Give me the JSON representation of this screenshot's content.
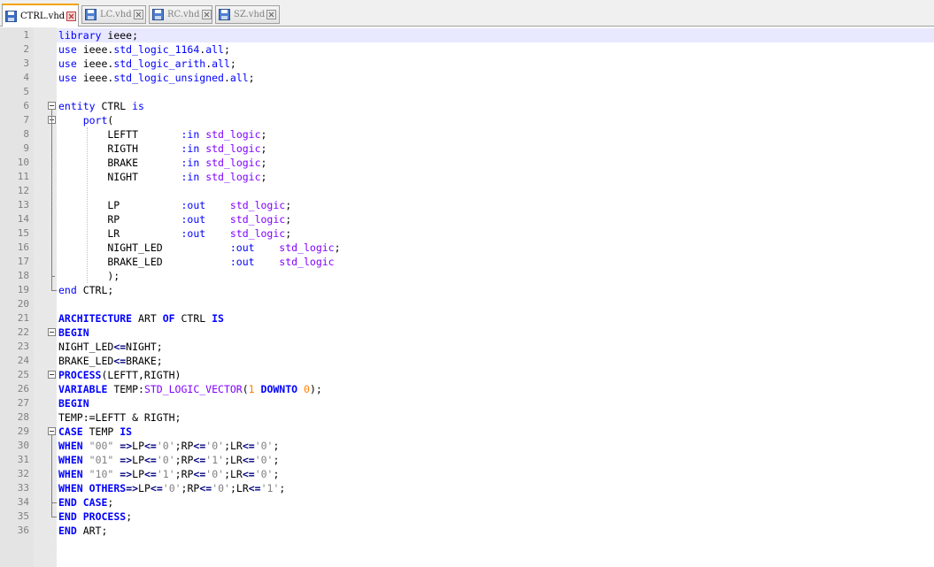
{
  "tabs": [
    {
      "label": "CTRL.vhd",
      "active": true,
      "icon": "save-icon"
    },
    {
      "label": "LC.vhd",
      "active": false,
      "icon": "save-icon"
    },
    {
      "label": "RC.vhd",
      "active": false,
      "icon": "save-icon"
    },
    {
      "label": "SZ.vhd",
      "active": false,
      "icon": "save-icon"
    }
  ],
  "colors": {
    "keyword": "#0000ff",
    "type": "#8000ff",
    "string": "#808080",
    "number": "#ff8000",
    "current_line": "#e8e8ff",
    "active_tab_accent": "#f4a300"
  },
  "editor": {
    "current_line": 1,
    "lines": [
      [
        [
          "k2",
          "library"
        ],
        [
          "id",
          " ieee;"
        ]
      ],
      [
        [
          "k2",
          "use"
        ],
        [
          "id",
          " ieee."
        ],
        [
          "k2",
          "std_logic_1164"
        ],
        [
          "id",
          "."
        ],
        [
          "k2",
          "all"
        ],
        [
          "id",
          ";"
        ]
      ],
      [
        [
          "k2",
          "use"
        ],
        [
          "id",
          " ieee."
        ],
        [
          "k2",
          "std_logic_arith"
        ],
        [
          "id",
          "."
        ],
        [
          "k2",
          "all"
        ],
        [
          "id",
          ";"
        ]
      ],
      [
        [
          "k2",
          "use"
        ],
        [
          "id",
          " ieee."
        ],
        [
          "k2",
          "std_logic_unsigned"
        ],
        [
          "id",
          "."
        ],
        [
          "k2",
          "all"
        ],
        [
          "id",
          ";"
        ]
      ],
      [],
      [
        [
          "k2",
          "entity"
        ],
        [
          "id",
          " CTRL "
        ],
        [
          "k2",
          "is"
        ]
      ],
      [
        [
          "id",
          "    "
        ],
        [
          "k2",
          "port"
        ],
        [
          "id",
          "("
        ]
      ],
      [
        [
          "id",
          "        LEFTT       "
        ],
        [
          "k2",
          ":in"
        ],
        [
          "id",
          " "
        ],
        [
          "ty",
          "std_logic"
        ],
        [
          "id",
          ";"
        ]
      ],
      [
        [
          "id",
          "        RIGTH       "
        ],
        [
          "k2",
          ":in"
        ],
        [
          "id",
          " "
        ],
        [
          "ty",
          "std_logic"
        ],
        [
          "id",
          ";"
        ]
      ],
      [
        [
          "id",
          "        BRAKE       "
        ],
        [
          "k2",
          ":in"
        ],
        [
          "id",
          " "
        ],
        [
          "ty",
          "std_logic"
        ],
        [
          "id",
          ";"
        ]
      ],
      [
        [
          "id",
          "        NIGHT       "
        ],
        [
          "k2",
          ":in"
        ],
        [
          "id",
          " "
        ],
        [
          "ty",
          "std_logic"
        ],
        [
          "id",
          ";"
        ]
      ],
      [],
      [
        [
          "id",
          "        LP          "
        ],
        [
          "k2",
          ":out"
        ],
        [
          "id",
          "    "
        ],
        [
          "ty",
          "std_logic"
        ],
        [
          "id",
          ";"
        ]
      ],
      [
        [
          "id",
          "        RP          "
        ],
        [
          "k2",
          ":out"
        ],
        [
          "id",
          "    "
        ],
        [
          "ty",
          "std_logic"
        ],
        [
          "id",
          ";"
        ]
      ],
      [
        [
          "id",
          "        LR          "
        ],
        [
          "k2",
          ":out"
        ],
        [
          "id",
          "    "
        ],
        [
          "ty",
          "std_logic"
        ],
        [
          "id",
          ";"
        ]
      ],
      [
        [
          "id",
          "        NIGHT_LED           "
        ],
        [
          "k2",
          ":out"
        ],
        [
          "id",
          "    "
        ],
        [
          "ty",
          "std_logic"
        ],
        [
          "id",
          ";"
        ]
      ],
      [
        [
          "id",
          "        BRAKE_LED           "
        ],
        [
          "k2",
          ":out"
        ],
        [
          "id",
          "    "
        ],
        [
          "ty",
          "std_logic"
        ]
      ],
      [
        [
          "id",
          "        );"
        ]
      ],
      [
        [
          "k2",
          "end"
        ],
        [
          "id",
          " CTRL;"
        ]
      ],
      [],
      [
        [
          "kw",
          "ARCHITECTURE"
        ],
        [
          "id",
          " ART "
        ],
        [
          "kw",
          "OF"
        ],
        [
          "id",
          " CTRL "
        ],
        [
          "kw",
          "IS"
        ]
      ],
      [
        [
          "kw",
          "BEGIN"
        ]
      ],
      [
        [
          "id",
          "NIGHT_LED"
        ],
        [
          "op",
          "<="
        ],
        [
          "id",
          "NIGHT;"
        ]
      ],
      [
        [
          "id",
          "BRAKE_LED"
        ],
        [
          "op",
          "<="
        ],
        [
          "id",
          "BRAKE;"
        ]
      ],
      [
        [
          "kw",
          "PROCESS"
        ],
        [
          "id",
          "(LEFTT,RIGTH)"
        ]
      ],
      [
        [
          "kw",
          "VARIABLE"
        ],
        [
          "id",
          " TEMP:"
        ],
        [
          "ty",
          "STD_LOGIC_VECTOR"
        ],
        [
          "id",
          "("
        ],
        [
          "nm",
          "1"
        ],
        [
          "id",
          " "
        ],
        [
          "kw",
          "DOWNTO"
        ],
        [
          "id",
          " "
        ],
        [
          "nm",
          "0"
        ],
        [
          "id",
          ");"
        ]
      ],
      [
        [
          "kw",
          "BEGIN"
        ]
      ],
      [
        [
          "id",
          "TEMP:=LEFTT & RIGTH;"
        ]
      ],
      [
        [
          "kw",
          "CASE"
        ],
        [
          "id",
          " TEMP "
        ],
        [
          "kw",
          "IS"
        ]
      ],
      [
        [
          "kw",
          "WHEN"
        ],
        [
          "id",
          " "
        ],
        [
          "st",
          "\"00\""
        ],
        [
          "id",
          " "
        ],
        [
          "op",
          "=>"
        ],
        [
          "id",
          "LP"
        ],
        [
          "op",
          "<="
        ],
        [
          "st",
          "'0'"
        ],
        [
          "id",
          ";RP"
        ],
        [
          "op",
          "<="
        ],
        [
          "st",
          "'0'"
        ],
        [
          "id",
          ";LR"
        ],
        [
          "op",
          "<="
        ],
        [
          "st",
          "'0'"
        ],
        [
          "id",
          ";"
        ]
      ],
      [
        [
          "kw",
          "WHEN"
        ],
        [
          "id",
          " "
        ],
        [
          "st",
          "\"01\""
        ],
        [
          "id",
          " "
        ],
        [
          "op",
          "=>"
        ],
        [
          "id",
          "LP"
        ],
        [
          "op",
          "<="
        ],
        [
          "st",
          "'0'"
        ],
        [
          "id",
          ";RP"
        ],
        [
          "op",
          "<="
        ],
        [
          "st",
          "'1'"
        ],
        [
          "id",
          ";LR"
        ],
        [
          "op",
          "<="
        ],
        [
          "st",
          "'0'"
        ],
        [
          "id",
          ";"
        ]
      ],
      [
        [
          "kw",
          "WHEN"
        ],
        [
          "id",
          " "
        ],
        [
          "st",
          "\"10\""
        ],
        [
          "id",
          " "
        ],
        [
          "op",
          "=>"
        ],
        [
          "id",
          "LP"
        ],
        [
          "op",
          "<="
        ],
        [
          "st",
          "'1'"
        ],
        [
          "id",
          ";RP"
        ],
        [
          "op",
          "<="
        ],
        [
          "st",
          "'0'"
        ],
        [
          "id",
          ";LR"
        ],
        [
          "op",
          "<="
        ],
        [
          "st",
          "'0'"
        ],
        [
          "id",
          ";"
        ]
      ],
      [
        [
          "kw",
          "WHEN"
        ],
        [
          "id",
          " "
        ],
        [
          "kw",
          "OTHERS"
        ],
        [
          "op",
          "=>"
        ],
        [
          "id",
          "LP"
        ],
        [
          "op",
          "<="
        ],
        [
          "st",
          "'0'"
        ],
        [
          "id",
          ";RP"
        ],
        [
          "op",
          "<="
        ],
        [
          "st",
          "'0'"
        ],
        [
          "id",
          ";LR"
        ],
        [
          "op",
          "<="
        ],
        [
          "st",
          "'1'"
        ],
        [
          "id",
          ";"
        ]
      ],
      [
        [
          "kw",
          "END"
        ],
        [
          "id",
          " "
        ],
        [
          "kw",
          "CASE"
        ],
        [
          "id",
          ";"
        ]
      ],
      [
        [
          "kw",
          "END"
        ],
        [
          "id",
          " "
        ],
        [
          "kw",
          "PROCESS"
        ],
        [
          "id",
          ";"
        ]
      ],
      [
        [
          "kw",
          "END"
        ],
        [
          "id",
          " ART;"
        ]
      ]
    ]
  }
}
